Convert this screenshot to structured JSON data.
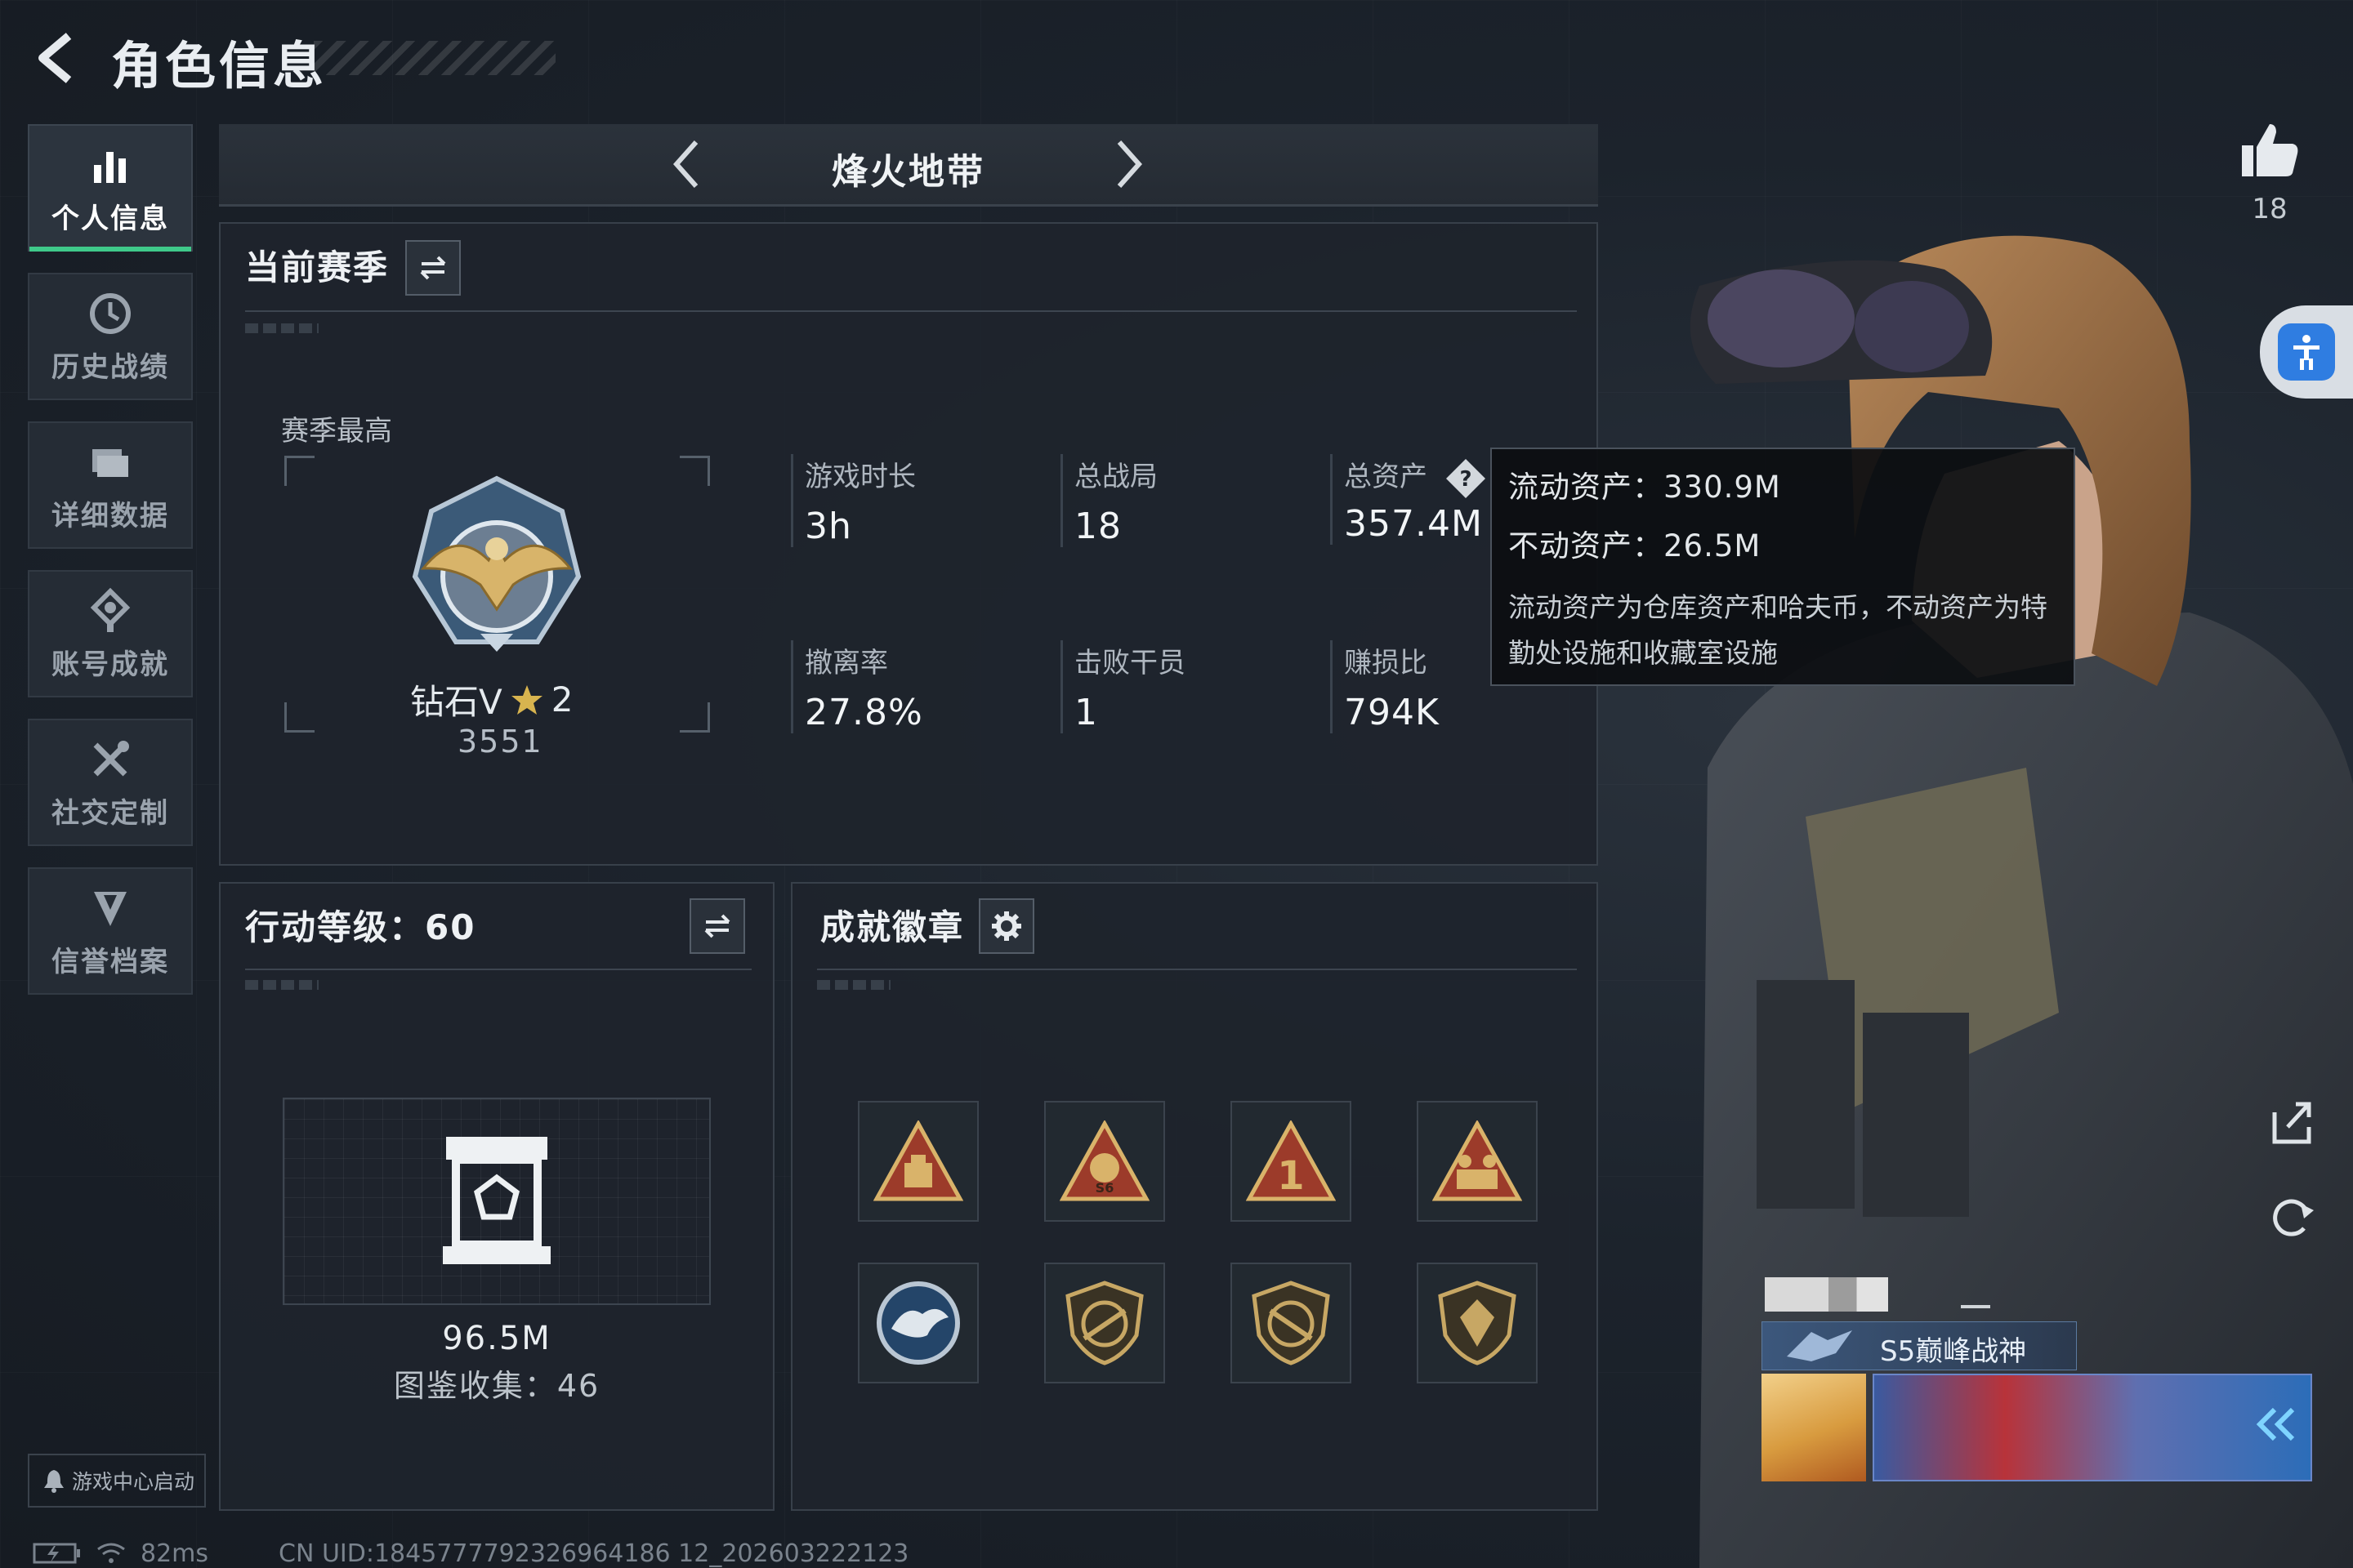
{
  "header": {
    "title": "角色信息"
  },
  "sidebar": {
    "items": [
      {
        "label": "个人信息",
        "icon": "bar-chart-icon",
        "active": true
      },
      {
        "label": "历史战绩",
        "icon": "history-icon",
        "active": false
      },
      {
        "label": "详细数据",
        "icon": "folder-icon",
        "active": false
      },
      {
        "label": "账号成就",
        "icon": "achievement-icon",
        "active": false
      },
      {
        "label": "社交定制",
        "icon": "tools-icon",
        "active": false
      },
      {
        "label": "信誉档案",
        "icon": "shield-icon",
        "active": false
      }
    ],
    "game_center": "游戏中心启动"
  },
  "mode": {
    "title": "烽火地带"
  },
  "season": {
    "title": "当前赛季",
    "best_label": "赛季最高",
    "rank": "钻石V",
    "stars": "2",
    "score": "3551",
    "stats": [
      {
        "key": "游戏时长",
        "value": "3h"
      },
      {
        "key": "总战局",
        "value": "18"
      },
      {
        "key": "总资产",
        "value": "357.4M"
      },
      {
        "key": "撤离率",
        "value": "27.8%"
      },
      {
        "key": "击败干员",
        "value": "1"
      },
      {
        "key": "赚损比",
        "value": "794K"
      }
    ]
  },
  "tooltip": {
    "liquid": "流动资产：330.9M",
    "fixed": "不动资产：26.5M",
    "desc": "流动资产为仓库资产和哈夫币，不动资产为特勤处设施和收藏室设施"
  },
  "action_level": {
    "title": "行动等级：60",
    "amount": "96.5M",
    "collection": "图鉴收集：46"
  },
  "badges": {
    "title": "成就徽章",
    "items": [
      "badge-crate-icon",
      "badge-s6-icon",
      "badge-rank1-icon",
      "badge-squad-icon",
      "badge-eagle-icon",
      "badge-rifle-icon",
      "badge-rifle2-icon",
      "badge-emblem-icon"
    ]
  },
  "profile": {
    "likes": "18",
    "title_badge": "S5巅峰战神"
  },
  "status": {
    "ping": "82ms",
    "uid": "CN UID:1845777792326964186 12_202603222123"
  },
  "colors": {
    "accent": "#3fc98a",
    "panel": "#1e242c",
    "bg": "#1a2029"
  }
}
